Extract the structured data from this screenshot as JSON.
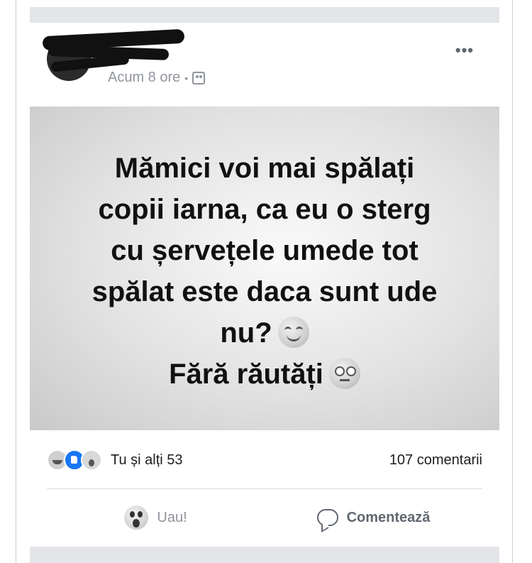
{
  "post": {
    "timestamp": "Acum 8 ore",
    "separator": "•",
    "audience_icon": "friends-icon",
    "more_label": "•••",
    "image_text": {
      "lines": [
        "Mămici voi mai spălați",
        "copii iarna, ca eu o sterg",
        "cu șervețele umede tot",
        "spălat este daca sunt ude",
        "nu?",
        "Fără răutăți"
      ]
    },
    "reactions": {
      "icons": [
        "haha-icon",
        "like-icon",
        "wow-icon"
      ],
      "summary": "Tu și alți 53",
      "comments": "107 comentarii"
    },
    "actions": {
      "reaction_label": "Uau!",
      "comment_label": "Comentează"
    }
  },
  "colors": {
    "accent_like": "#1877f2",
    "meta_gray": "#90949c",
    "background_strip": "#e4e5e9"
  }
}
